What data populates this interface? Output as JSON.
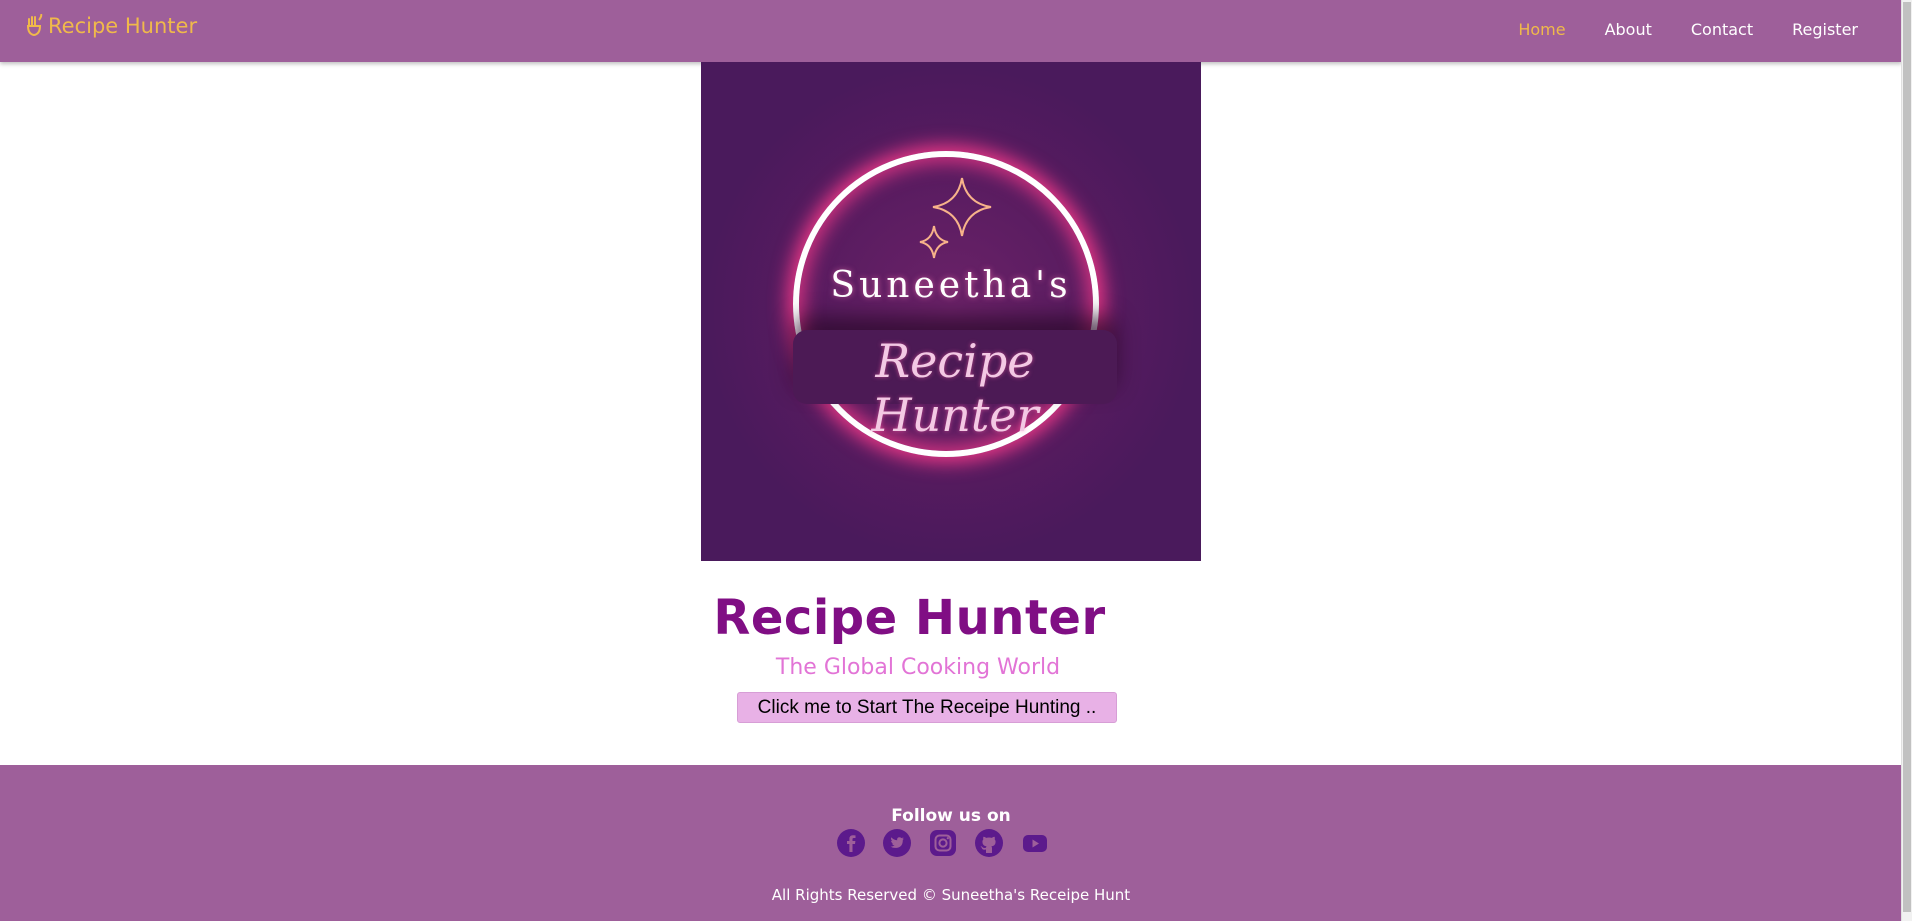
{
  "navbar": {
    "brand": "Recipe Hunter",
    "links": [
      {
        "label": "Home",
        "active": true
      },
      {
        "label": "About",
        "active": false
      },
      {
        "label": "Contact",
        "active": false
      },
      {
        "label": "Register",
        "active": false
      }
    ]
  },
  "logo": {
    "top_text": "Suneetha's",
    "script_text": "Recipe Hunter"
  },
  "hero": {
    "title": "Recipe Hunter",
    "subtitle": "The Global Cooking World",
    "cta_label": "Click me to Start The Receipe Hunting .."
  },
  "footer": {
    "follow_label": "Follow us on",
    "socials": [
      "facebook-icon",
      "twitter-icon",
      "instagram-icon",
      "github-icon",
      "youtube-icon"
    ],
    "copyright": "All Rights Reserved © Suneetha's Receipe Hunt"
  },
  "colors": {
    "nav_bg": "#9e5f9a",
    "brand_accent": "#f0b94a",
    "title": "#800e84",
    "subtitle": "#e274d6",
    "button_bg": "#e8b1e6",
    "social_icon": "#5c1a8c"
  }
}
